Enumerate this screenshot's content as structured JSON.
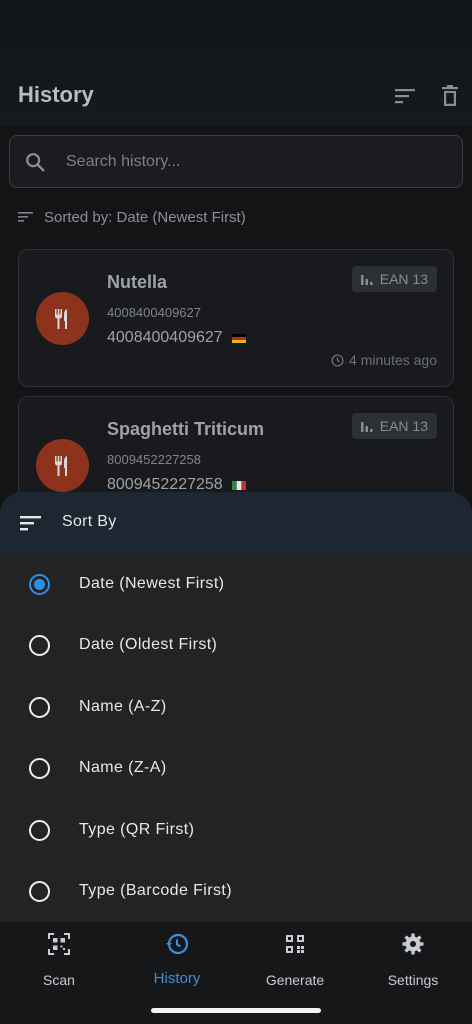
{
  "app": {
    "title": "History",
    "accent_color": "#2d8fe6",
    "actions": [
      {
        "name": "sort-icon"
      },
      {
        "name": "trash-icon"
      }
    ]
  },
  "search": {
    "placeholder": "Search history...",
    "value": ""
  },
  "sorted_by": "Sorted by: Date (Newest First)",
  "history": [
    {
      "name": "Nutella",
      "code_small": "4008400409627",
      "code": "4008400409627",
      "flag": "germany-flag",
      "type": "EAN 13",
      "time": "4 minutes ago",
      "icon": "restaurant-icon"
    },
    {
      "name": "Spaghetti Triticum",
      "code_small": "8009452227258",
      "code": "8009452227258",
      "flag": "italy-flag",
      "type": "EAN 13",
      "icon": "restaurant-icon"
    }
  ],
  "sort_sheet": {
    "title": "Sort By",
    "options": [
      {
        "label": "Date (Newest First)",
        "selected": true
      },
      {
        "label": "Date (Oldest First)",
        "selected": false
      },
      {
        "label": "Name (A-Z)",
        "selected": false
      },
      {
        "label": "Name (Z-A)",
        "selected": false
      },
      {
        "label": "Type (QR First)",
        "selected": false
      },
      {
        "label": "Type (Barcode First)",
        "selected": false
      }
    ]
  },
  "nav": [
    {
      "label": "Scan",
      "icon": "qr-scan-icon",
      "active": false
    },
    {
      "label": "History",
      "icon": "history-icon",
      "active": true
    },
    {
      "label": "Generate",
      "icon": "qr-code-icon",
      "active": false
    },
    {
      "label": "Settings",
      "icon": "gear-icon",
      "active": false
    }
  ]
}
